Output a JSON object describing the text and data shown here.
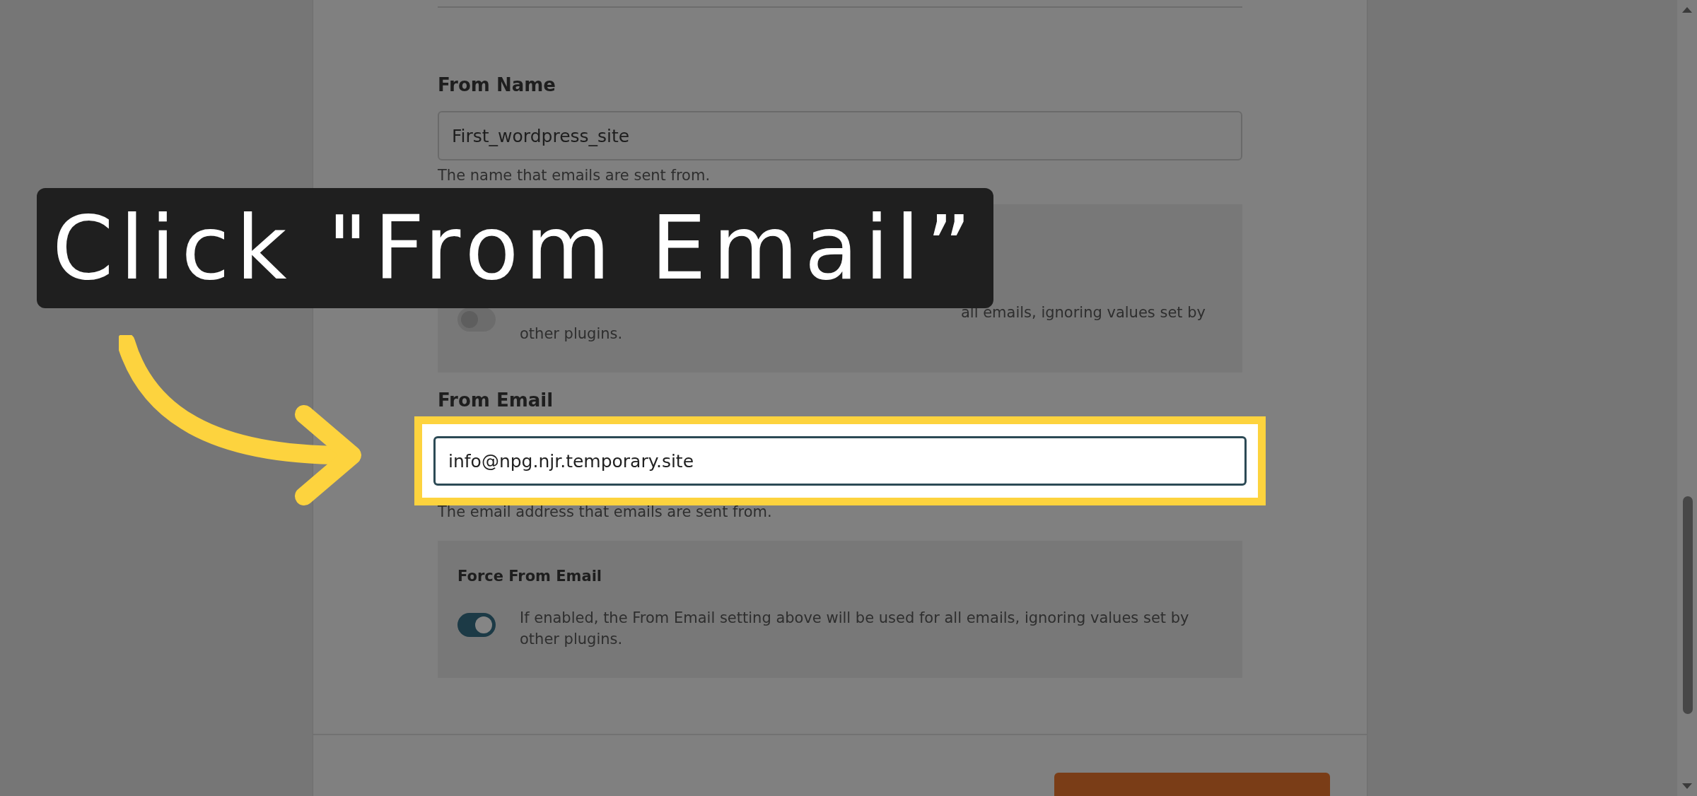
{
  "callout": {
    "text": "Click \"From Email”"
  },
  "fields": [
    {
      "label": "From Name",
      "value": "First_wordpress_site",
      "help": "The name that emails are sent from.",
      "highlighted": false,
      "force": {
        "on": false,
        "lines": [
          {
            "kind": "tail",
            "text": "all emails, ignoring values set by"
          },
          {
            "kind": "full",
            "text": "other plugins."
          }
        ]
      }
    },
    {
      "label": "From Email",
      "value": "info@npg.njr.temporary.site",
      "help": "The email address that emails are sent from.",
      "highlighted": true,
      "force": {
        "label": "Force From Email",
        "on": true,
        "lines": [
          {
            "kind": "full",
            "text": "If enabled, the From Email setting above will be used for all emails, ignoring values set by"
          },
          {
            "kind": "full",
            "text": "other plugins."
          }
        ]
      }
    }
  ]
}
